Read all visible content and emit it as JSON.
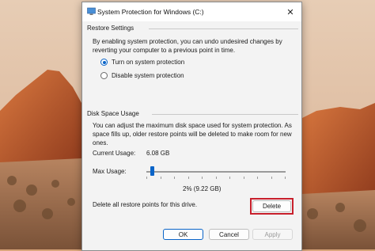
{
  "dialog": {
    "title": "System Protection for Windows (C:)",
    "close_glyph": "✕"
  },
  "restore_settings": {
    "heading": "Restore Settings",
    "description": "By enabling system protection, you can undo undesired changes by reverting your computer to a previous point in time.",
    "options": [
      {
        "label": "Turn on system protection",
        "checked": true
      },
      {
        "label": "Disable system protection",
        "checked": false
      }
    ]
  },
  "disk_space": {
    "heading": "Disk Space Usage",
    "description": "You can adjust the maximum disk space used for system protection. As space fills up, older restore points will be deleted to make room for new ones.",
    "current_usage_label": "Current Usage:",
    "current_usage_value": "6.08 GB",
    "max_usage_label": "Max Usage:",
    "max_usage_fraction": 0.02,
    "max_usage_readout": "2% (9.22 GB)",
    "delete_text": "Delete all restore points for this drive.",
    "delete_label": "Delete"
  },
  "footer": {
    "ok_label": "OK",
    "cancel_label": "Cancel",
    "apply_label": "Apply"
  },
  "colors": {
    "accent": "#0a64c8",
    "highlight": "#c8202c"
  }
}
